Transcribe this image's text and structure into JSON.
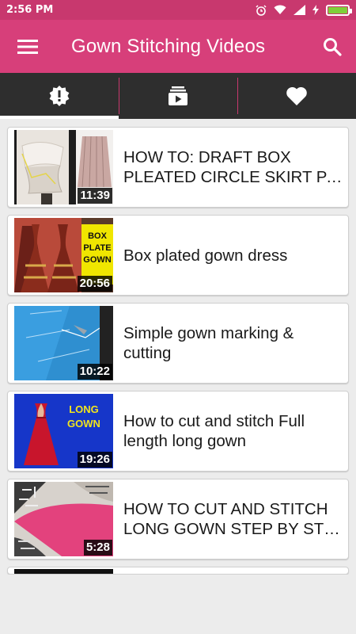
{
  "status": {
    "time": "2:56 PM"
  },
  "app_bar": {
    "title": "Gown Stitching Videos"
  },
  "tabs": [
    {
      "icon": "alert-badge-icon"
    },
    {
      "icon": "video-library-icon"
    },
    {
      "icon": "heart-icon"
    }
  ],
  "videos": [
    {
      "title_lines": [
        "HOW TO: DRAFT BOX",
        "PLEATED CIRCLE SKIRT PA..."
      ],
      "duration": "11:39"
    },
    {
      "title_lines": [
        "Box plated gown dress"
      ],
      "duration": "20:56",
      "thumb_text": [
        "BOX",
        "PLATE",
        "GOWN"
      ]
    },
    {
      "title_lines": [
        "Simple gown marking &",
        "cutting"
      ],
      "duration": "10:22"
    },
    {
      "title_lines": [
        "How to cut and stitch Full",
        "length long gown"
      ],
      "duration": "19:26",
      "thumb_text": [
        "LONG",
        "GOWN"
      ]
    },
    {
      "title_lines": [
        "HOW TO CUT AND STITCH",
        "LONG GOWN STEP BY STE..."
      ],
      "duration": "5:28"
    }
  ],
  "colors": {
    "status_bar": "#c8386e",
    "app_bar": "#d73f7a",
    "tab_bar": "#2e2e2e",
    "battery": "#7ed03a"
  }
}
